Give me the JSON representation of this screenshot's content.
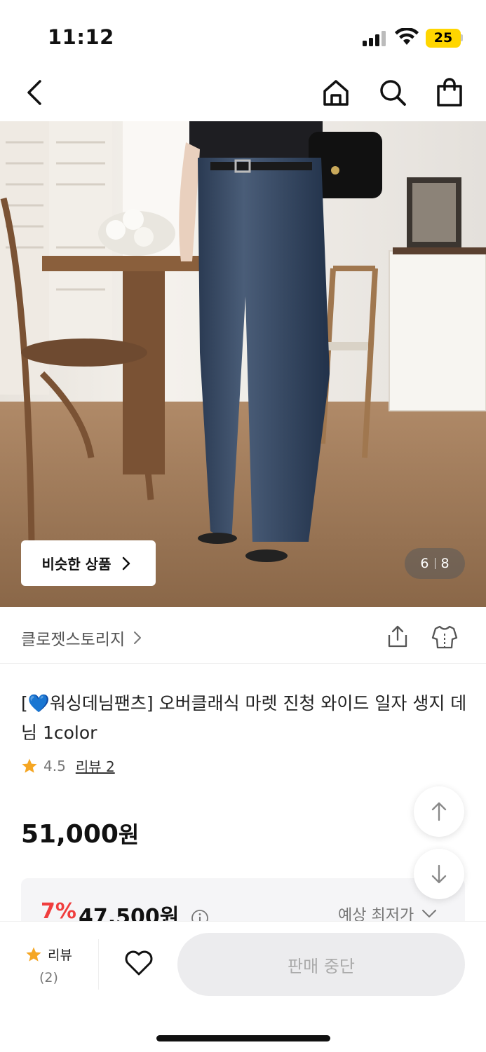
{
  "status": {
    "time": "11:12",
    "battery": "25"
  },
  "nav": {
    "icons": [
      "back-icon",
      "home-icon",
      "search-icon",
      "shopping-bag-icon"
    ]
  },
  "hero": {
    "similar_label": "비슷한 상품",
    "current": "6",
    "total": "8"
  },
  "brand": {
    "name": "클로젯스토리지"
  },
  "product": {
    "title": "[💙워싱데님팬츠] 오버클래식 마렛 진청 와이드 일자 생지 데님 1color",
    "rating": "4.5",
    "review_link": "리뷰 2",
    "price": "51,000",
    "price_unit": "원",
    "discount": "7%",
    "sale_price": "47,500원",
    "expect_label": "예상 최저가"
  },
  "bottom": {
    "review_label": "리뷰",
    "review_count": "(2)",
    "soldout_label": "판매 중단"
  },
  "colors": {
    "accent": "#f03e3e",
    "star": "#f5a623",
    "battery": "#ffd600"
  }
}
